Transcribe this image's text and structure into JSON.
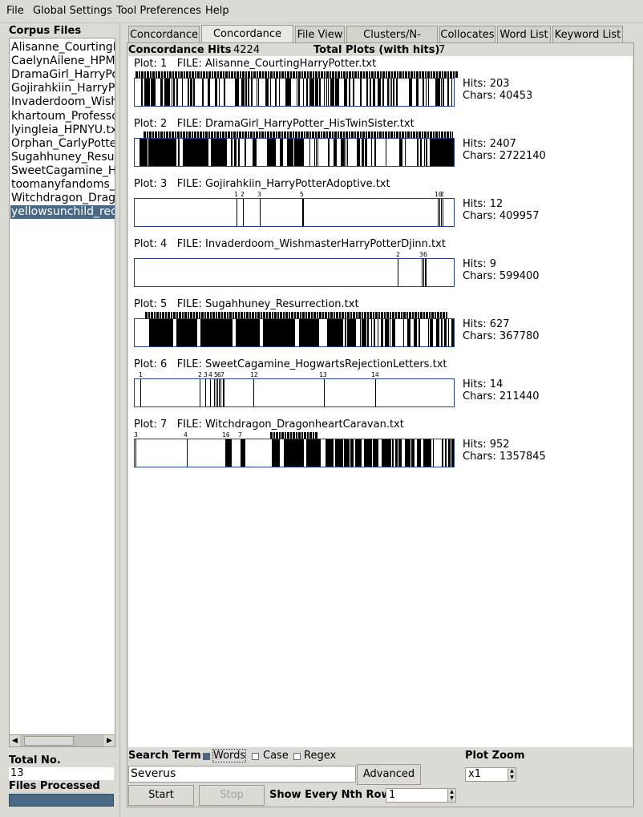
{
  "menu": [
    "File",
    "Global Settings",
    "Tool Preferences",
    "Help"
  ],
  "left_panel": {
    "corpus_title": "Corpus Files",
    "files": [
      "Alisanne_CourtingH",
      "CaelynAilene_HPMe",
      "DramaGirl_HarryPo",
      "Gojirahkiin_HarryPo",
      "Invaderdoom_Wishi",
      "khartoum_Professo",
      "lyingleia_HPNYU.tx",
      "Orphan_CarlyPotter",
      "Sugahhuney_Resurr",
      "SweetCagamine_Ho",
      "toomanyfandoms_H",
      "Witchdragon_Drago",
      "yellowsunchild_reco"
    ],
    "selected_index": 12,
    "total_label": "Total No.",
    "total_value": "13",
    "files_processed_label": "Files Processed",
    "progress_fraction": 1.0
  },
  "tabs": [
    "Concordance",
    "Concordance Plot",
    "File View",
    "Clusters/N-Grams",
    "Collocates",
    "Word List",
    "Keyword List"
  ],
  "active_tab": "Concordance Plot",
  "summary": {
    "hits_label": "Concordance Hits",
    "hits_value": "4224",
    "plots_label": "Total Plots (with hits)",
    "plots_value": "7"
  },
  "plots": [
    {
      "plot_label": "Plot: 1",
      "file_label": "FILE: Alisanne_CourtingHarryPotter.txt",
      "hits": "Hits: 203",
      "chars": "Chars: 40453"
    },
    {
      "plot_label": "Plot: 2",
      "file_label": "FILE: DramaGirl_HarryPotter_HisTwinSister.txt",
      "hits": "Hits: 2407",
      "chars": "Chars: 2722140"
    },
    {
      "plot_label": "Plot: 3",
      "file_label": "FILE: Gojirahkiin_HarryPotterAdoptive.txt",
      "hits": "Hits: 12",
      "chars": "Chars: 409957"
    },
    {
      "plot_label": "Plot: 4",
      "file_label": "FILE: Invaderdoom_WishmasterHarryPotterDjinn.txt",
      "hits": "Hits: 9",
      "chars": "Chars: 599400"
    },
    {
      "plot_label": "Plot: 5",
      "file_label": "FILE: Sugahhuney_Resurrection.txt",
      "hits": "Hits: 627",
      "chars": "Chars: 367780"
    },
    {
      "plot_label": "Plot: 6",
      "file_label": "FILE: SweetCagamine_HogwartsRejectionLetters.txt",
      "hits": "Hits: 14",
      "chars": "Chars: 211440"
    },
    {
      "plot_label": "Plot: 7",
      "file_label": "FILE: Witchdragon_DragonheartCaravan.txt",
      "hits": "Hits: 952",
      "chars": "Chars: 1357845"
    }
  ],
  "search": {
    "label": "Search Term",
    "words_label": "Words",
    "words_checked": true,
    "case_label": "Case",
    "case_checked": false,
    "regex_label": "Regex",
    "regex_checked": false,
    "term": "Severus",
    "advanced_label": "Advanced",
    "start_label": "Start",
    "stop_label": "Stop",
    "nth_label": "Show Every Nth Row",
    "nth_value": "1",
    "zoom_label": "Plot Zoom",
    "zoom_value": "x1"
  },
  "colors": {
    "selection": "#4a6984",
    "plot_border": "#1f3f8a",
    "hit_mark": "#000000"
  }
}
